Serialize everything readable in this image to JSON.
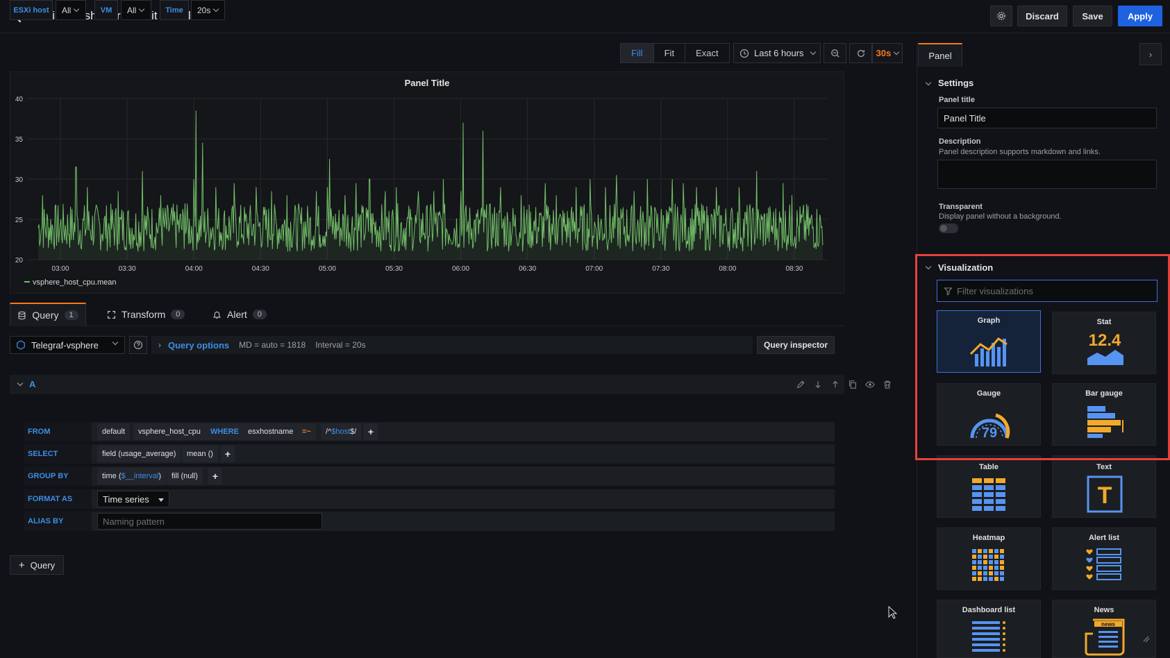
{
  "header": {
    "title": "First dashboard / Edit Panel",
    "discard": "Discard",
    "save": "Save",
    "apply": "Apply"
  },
  "variables": [
    {
      "label": "ESXi host",
      "value": "All"
    },
    {
      "label": "VM",
      "value": "All"
    },
    {
      "label": "Time",
      "value": "20s"
    }
  ],
  "fit_modes": [
    "Fill",
    "Fit",
    "Exact"
  ],
  "fit_active": "Fill",
  "time_range": "Last 6 hours",
  "refresh": "30s",
  "panel": {
    "title": "Panel Title",
    "legend": "vsphere_host_cpu.mean"
  },
  "chart_data": {
    "type": "line",
    "title": "Panel Title",
    "x_ticks": [
      "03:00",
      "03:30",
      "04:00",
      "04:30",
      "05:00",
      "05:30",
      "06:00",
      "06:30",
      "07:00",
      "07:30",
      "08:00",
      "08:30"
    ],
    "y_ticks": [
      20,
      25,
      30,
      35,
      40
    ],
    "ylim": [
      20,
      40
    ],
    "xlim": [
      "02:45",
      "08:45"
    ],
    "grid": true,
    "series": [
      {
        "name": "vsphere_host_cpu.mean",
        "color": "#73bf69",
        "baseline": 24,
        "noise": 3,
        "spikes": [
          [
            "02:52",
            28
          ],
          [
            "03:07",
            31.5
          ],
          [
            "03:12",
            29
          ],
          [
            "03:26",
            28.5
          ],
          [
            "03:37",
            31
          ],
          [
            "03:45",
            28
          ],
          [
            "03:56",
            27
          ],
          [
            "04:00",
            30
          ],
          [
            "04:01",
            38.5
          ],
          [
            "04:04",
            34.5
          ],
          [
            "04:10",
            29
          ],
          [
            "04:18",
            29.5
          ],
          [
            "04:28",
            29
          ],
          [
            "04:35",
            28.5
          ],
          [
            "04:42",
            28
          ],
          [
            "04:55",
            28.5
          ],
          [
            "05:00",
            29
          ],
          [
            "05:01",
            32.5
          ],
          [
            "05:08",
            28
          ],
          [
            "05:13",
            29.5
          ],
          [
            "05:19",
            30
          ],
          [
            "05:26",
            28.5
          ],
          [
            "05:31",
            29
          ],
          [
            "05:41",
            28.5
          ],
          [
            "05:48",
            28.5
          ],
          [
            "05:52",
            30
          ],
          [
            "06:00",
            28.5
          ],
          [
            "06:01",
            37
          ],
          [
            "06:10",
            36
          ],
          [
            "06:18",
            29
          ],
          [
            "06:27",
            28
          ],
          [
            "06:38",
            29.5
          ],
          [
            "06:43",
            28
          ],
          [
            "06:52",
            29
          ],
          [
            "06:58",
            30
          ],
          [
            "07:05",
            29
          ],
          [
            "07:10",
            30.5
          ],
          [
            "07:18",
            28.5
          ],
          [
            "07:24",
            30
          ],
          [
            "07:35",
            30
          ],
          [
            "07:40",
            29.5
          ],
          [
            "07:46",
            29
          ],
          [
            "07:55",
            29
          ],
          [
            "08:05",
            29
          ],
          [
            "08:13",
            31
          ],
          [
            "08:25",
            29.5
          ],
          [
            "08:29",
            28
          ]
        ]
      }
    ]
  },
  "tabs": [
    {
      "label": "Query",
      "count": "1"
    },
    {
      "label": "Transform",
      "count": "0"
    },
    {
      "label": "Alert",
      "count": "0"
    }
  ],
  "datasource": "Telegraf-vsphere",
  "query_options": {
    "label": "Query options",
    "md": "MD = auto = 1818",
    "interval": "Interval = 20s"
  },
  "query_inspector": "Query inspector",
  "query": {
    "ref": "A",
    "from": {
      "kw": "FROM",
      "policy": "default",
      "measurement": "vsphere_host_cpu",
      "where": "WHERE",
      "tag": "esxhostname",
      "op": "=~",
      "value_prefix": "/^",
      "value_var": "$host",
      "value_suffix": "$/"
    },
    "select": {
      "kw": "SELECT",
      "field": "field (usage_average)",
      "fn": "mean ()"
    },
    "group_by": {
      "kw": "GROUP BY",
      "time_prefix": "time (",
      "time_var": "$__interval",
      "time_suffix": ")",
      "fill": "fill (null)"
    },
    "format_as": {
      "kw": "FORMAT AS",
      "value": "Time series"
    },
    "alias_by": {
      "kw": "ALIAS BY",
      "placeholder": "Naming pattern"
    }
  },
  "add_query": "Query",
  "sidebar": {
    "tab": "Panel",
    "settings": "Settings",
    "panel_title_label": "Panel title",
    "panel_title_value": "Panel Title",
    "description_label": "Description",
    "description_hint": "Panel description supports markdown and links.",
    "transparent_label": "Transparent",
    "transparent_hint": "Display panel without a background.",
    "visualization": "Visualization",
    "filter_placeholder": "Filter visualizations",
    "viz": [
      {
        "name": "Graph",
        "icon": "graph-viz-icon"
      },
      {
        "name": "Stat",
        "icon": "stat-viz-icon",
        "value": "12.4"
      },
      {
        "name": "Gauge",
        "icon": "gauge-viz-icon",
        "value": "79"
      },
      {
        "name": "Bar gauge",
        "icon": "bar-gauge-viz-icon"
      },
      {
        "name": "Table",
        "icon": "table-viz-icon"
      },
      {
        "name": "Text",
        "icon": "text-viz-icon",
        "value": "T"
      },
      {
        "name": "Heatmap",
        "icon": "heatmap-viz-icon"
      },
      {
        "name": "Alert list",
        "icon": "alert-list-viz-icon"
      },
      {
        "name": "Dashboard list",
        "icon": "dashboard-list-viz-icon"
      },
      {
        "name": "News",
        "icon": "news-viz-icon",
        "value": "news"
      }
    ]
  }
}
